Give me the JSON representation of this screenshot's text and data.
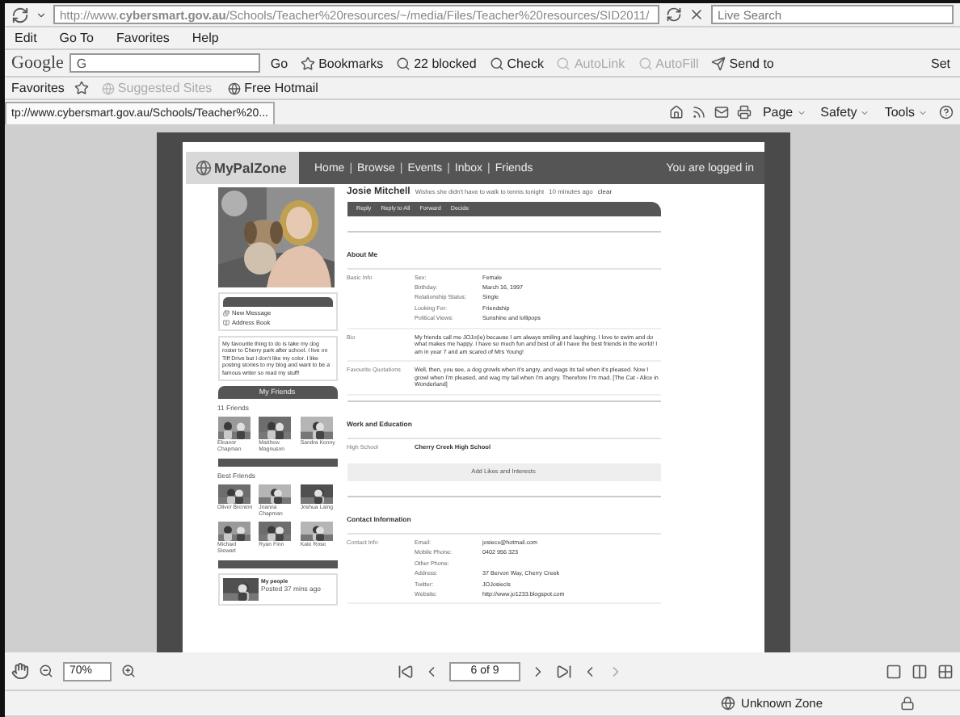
{
  "browser": {
    "address": "http://www.**cybersmart.gov.au**/Schools/Teacher%20resources/~/media/Files/Teacher%20resources/SID2011/",
    "search_placeholder": "Live Search",
    "menu": [
      "Edit",
      "Go To",
      "Favorites",
      "Help"
    ],
    "google_toolbar": {
      "brand": "Google",
      "field_text": "G",
      "go": "Go",
      "items": [
        {
          "label": "Bookmarks",
          "disabled": false
        },
        {
          "label": "22 blocked",
          "disabled": false
        },
        {
          "label": "Check",
          "disabled": false
        },
        {
          "label": "AutoLink",
          "disabled": true
        },
        {
          "label": "AutoFill",
          "disabled": true
        },
        {
          "label": "Send to",
          "disabled": false
        }
      ],
      "settings": "Set"
    },
    "favorites_bar": {
      "label": "Favorites",
      "links": [
        {
          "label": "Suggested Sites",
          "disabled": true
        },
        {
          "label": "Free Hotmail",
          "disabled": false
        }
      ]
    },
    "tab_title": "tp://www.cybersmart.gov.au/Schools/Teacher%20...",
    "commands": [
      "Page",
      "Safety",
      "Tools"
    ]
  },
  "document": {
    "site": {
      "logo": "MyPalZone",
      "nav": [
        {
          "kind": "link",
          "text": "Home"
        },
        {
          "kind": "separator",
          "text": "|"
        },
        {
          "kind": "link",
          "text": "Browse"
        },
        {
          "kind": "separator",
          "text": "|"
        },
        {
          "kind": "link",
          "text": "Events"
        },
        {
          "kind": "separator",
          "text": "|"
        },
        {
          "kind": "link",
          "text": "Inbox"
        },
        {
          "kind": "separator",
          "text": "|"
        },
        {
          "kind": "link",
          "text": "Friends"
        }
      ],
      "login": "You are logged in"
    },
    "sidebar": {
      "actions": [
        "New Message",
        "Address Book"
      ],
      "blurb": "My favourite thing to do is take my dog roster to Cherry park after school. I live on Tiff Drive but I don't like my color. I like posting stories to my blog and want to be a famous writer so read my stuff!",
      "friends_title": "My Friends",
      "friends_count": "11 Friends",
      "friends": [
        {
          "name": "Eleanor Chapman"
        },
        {
          "name": "Matthew Magnuson"
        },
        {
          "name": "Sandra Kenny"
        }
      ],
      "best_title": "Best Friends",
      "best_friends": [
        {
          "name": "Oliver Brenton"
        },
        {
          "name": "Joanna Chapman"
        },
        {
          "name": "Joshua Laing"
        },
        {
          "name": "Michael Stewart"
        },
        {
          "name": "Ryan Finn"
        },
        {
          "name": "Kate Rose"
        }
      ],
      "post": {
        "title": "My people",
        "meta": "Posted 37 mins ago"
      }
    },
    "profile": {
      "name": "Josie Mitchell",
      "status": "Wishes she didn't have to walk to tennis tonight",
      "time": "10 minutes ago",
      "clear": "clear",
      "actions": [
        "Reply",
        "Reply to All",
        "Forward",
        "Decide"
      ],
      "sections": [
        {
          "title": "About Me",
          "groups": [
            {
              "label": "Basic Info",
              "kind": "pairs",
              "rows": [
                {
                  "key": "Sex:",
                  "value": "Female"
                },
                {
                  "key": "Birthday:",
                  "value": "March 16, 1997"
                },
                {
                  "key": "Relationship Status:",
                  "value": "Single"
                },
                {
                  "key": "Looking For:",
                  "value": "Friendship"
                },
                {
                  "key": "Political Views:",
                  "value": "Sunshine and lollipops"
                }
              ]
            },
            {
              "label": "Bio",
              "kind": "text",
              "text": "My friends call me JOJo(ie) because I am always smiling and laughing. I love to swim and do what makes me happy. I have so much fun and best of all I have the best friends in the world! I am in year 7 and am scared of Mrs Young!"
            },
            {
              "label": "Favourite Quotations",
              "kind": "text",
              "text": "Well, then, you see, a dog growls when it's angry, and wags its tail when it's pleased. Now I growl when I'm pleased, and wag my tail when I'm angry. Therefore I'm mad. [The Cat - Alice in Wonderland]"
            }
          ]
        },
        {
          "title": "Work and Education",
          "groups": [
            {
              "label": "High School",
              "kind": "bold",
              "text": "Cherry Creek High School"
            }
          ],
          "button": "Add Likes and Interests"
        },
        {
          "title": "Contact Information",
          "groups": [
            {
              "label": "Contact Info",
              "kind": "pairs",
              "rows": [
                {
                  "key": "Email:",
                  "value": "josiecx@hotmail.com"
                },
                {
                  "key": "Mobile Phone:",
                  "value": "0402 956 323"
                },
                {
                  "key": "Other Phone:"
                },
                {
                  "key": "Address:",
                  "value": "37 Bervon Way, Cherry Creek"
                },
                {
                  "key": "Twitter:",
                  "value": "JOJosiecls"
                },
                {
                  "key": "Website:",
                  "value": "http://www.jo1233.blogspot.com"
                }
              ]
            }
          ]
        }
      ]
    }
  },
  "pdf_toolbar": {
    "zoom": "70%",
    "page": "6 of 9"
  },
  "status_bar": {
    "zone": "Unknown Zone"
  }
}
